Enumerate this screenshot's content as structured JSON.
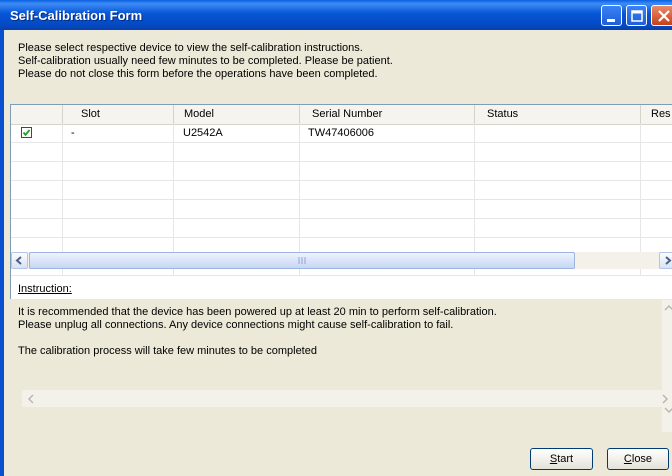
{
  "window": {
    "title": "Self-Calibration Form"
  },
  "intro": {
    "line1": "Please select respective device to view the self-calibration instructions.",
    "line2": "Self-calibration usually need few minutes to be completed. Please be patient.",
    "line3": "Please do not close this form before the operations have been completed."
  },
  "table": {
    "columns": [
      "Slot",
      "Model",
      "Serial Number",
      "Status",
      "Res"
    ],
    "rows": [
      {
        "checked": true,
        "slot": "-",
        "model": "U2542A",
        "serial": "TW47406006",
        "status": "",
        "result": ""
      }
    ]
  },
  "instruction": {
    "label": "Instruction:",
    "line1": "It is recommended that the device has been powered up at least 20 min to perform self-calibration.",
    "line2": "Please unplug all connections. Any device connections might cause self-calibration to fail.",
    "line3": "The calibration process will take few minutes to be completed"
  },
  "buttons": {
    "start_first": "S",
    "start_rest": "tart",
    "close_first": "C",
    "close_rest": "lose"
  },
  "icons": {
    "minimize": "minimize-icon",
    "maximize": "maximize-icon",
    "close": "close-icon",
    "check": "checkmark-icon"
  },
  "colors": {
    "titlebar": "#0756d6",
    "check": "#21a121"
  }
}
